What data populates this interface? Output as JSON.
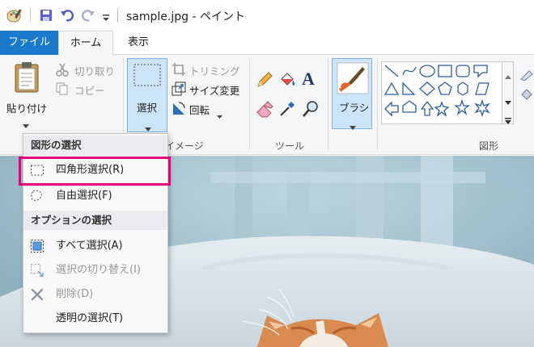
{
  "titlebar": {
    "title": "sample.jpg - ペイント"
  },
  "tabs": [
    {
      "label": "ファイル"
    },
    {
      "label": "ホーム"
    },
    {
      "label": "表示"
    }
  ],
  "ribbon": {
    "paste_label": "貼り付け",
    "cut_label": "切り取り",
    "copy_label": "コピー",
    "select_label": "選択",
    "crop_label": "トリミング",
    "resize_label": "サイズ変更",
    "rotate_label": "回転",
    "image_group_label": "イメージ",
    "tools_group_label": "ツール",
    "brush_label": "ブラシ",
    "shapes_group_label": "図形"
  },
  "menu": {
    "header1": "図形の選択",
    "header2": "オプションの選択",
    "items": [
      {
        "label": "四角形選択(R)",
        "enabled": true,
        "highlighted": true
      },
      {
        "label": "自由選択(F)",
        "enabled": true
      },
      {
        "label": "すべて選択(A)",
        "enabled": true
      },
      {
        "label": "選択の切り替え(I)",
        "enabled": false
      },
      {
        "label": "削除(D)",
        "enabled": false
      },
      {
        "label": "透明の選択(T)",
        "enabled": true
      }
    ]
  },
  "colors": {
    "file_tab_bg": "#1979ca",
    "highlight_border": "#e5007e",
    "select_button_bg": "#cce4f7",
    "accent_blue": "#3d7ebf"
  },
  "icons": {
    "app": "paint-app-icon",
    "save": "save-icon",
    "undo": "undo-icon",
    "redo": "redo-icon",
    "customize": "customize-qat-icon"
  }
}
